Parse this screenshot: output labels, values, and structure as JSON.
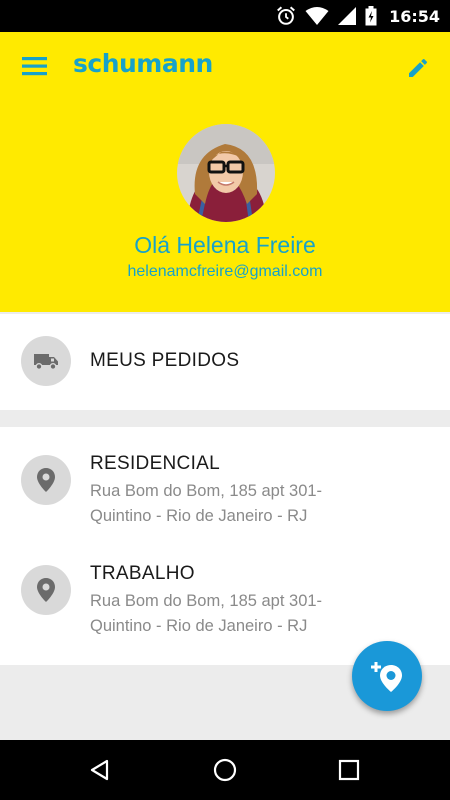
{
  "status_bar": {
    "time": "16:54",
    "icons": [
      "alarm-icon",
      "wifi-icon",
      "signal-icon",
      "battery-icon"
    ]
  },
  "header": {
    "app_name": "schumann",
    "menu_icon": "menu-icon",
    "edit_icon": "pencil-icon",
    "greeting": "Olá Helena Freire",
    "email": "helenamcfreire@gmail.com",
    "background_color": "#ffea00",
    "accent_color": "#17a2c9"
  },
  "orders": {
    "icon": "truck-icon",
    "label": "MEUS PEDIDOS"
  },
  "addresses": [
    {
      "icon": "location-pin-icon",
      "title": "RESIDENCIAL",
      "line1": "Rua Bom do Bom, 185 apt 301-",
      "line2": "Quintino - Rio de Janeiro - RJ"
    },
    {
      "icon": "location-pin-icon",
      "title": "TRABALHO",
      "line1": "Rua Bom do Bom, 185 apt 301-",
      "line2": "Quintino - Rio de Janeiro - RJ"
    }
  ],
  "fab": {
    "icon": "add-location-icon",
    "color": "#1a98d8"
  },
  "nav_bar": {
    "icons": [
      "back-icon",
      "home-icon",
      "recents-icon"
    ]
  }
}
